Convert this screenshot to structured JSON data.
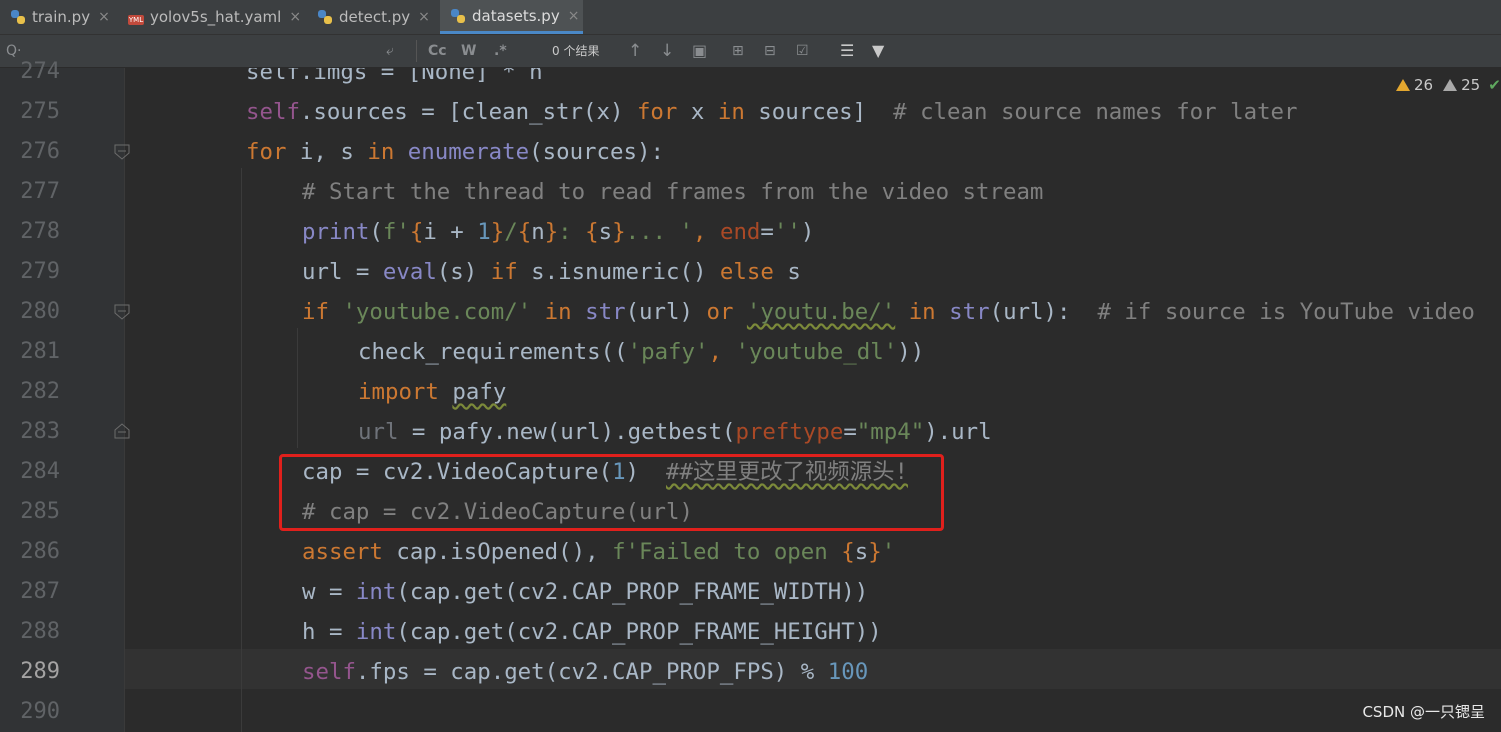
{
  "tabs": [
    {
      "label": "train.py",
      "icon": "python-file-icon",
      "active": false
    },
    {
      "label": "yolov5s_hat.yaml",
      "icon": "yaml-file-icon",
      "active": false
    },
    {
      "label": "detect.py",
      "icon": "python-file-icon",
      "active": false
    },
    {
      "label": "datasets.py",
      "icon": "python-file-icon",
      "active": true
    }
  ],
  "tab_close": "×",
  "find": {
    "search_glyph": "Q·",
    "match_case": "Cc",
    "words": "W",
    "regex": ".*",
    "results": "0 个结果"
  },
  "inspections": {
    "warnings": "26",
    "weak_warnings": "25"
  },
  "line_numbers": [
    "274",
    "275",
    "276",
    "277",
    "278",
    "279",
    "280",
    "281",
    "282",
    "283",
    "284",
    "285",
    "286",
    "287",
    "288",
    "289",
    "290"
  ],
  "code": {
    "l274": "self.imgs = [None] * n",
    "l275_a": "self",
    "l275_b": ".sources = [clean_str(x) ",
    "l275_c": "for",
    "l275_d": " x ",
    "l275_e": "in",
    "l275_f": " sources]  ",
    "l275_g": "# clean source names for later",
    "l276_a": "for",
    "l276_b": " i, s ",
    "l276_c": "in",
    "l276_d": " ",
    "l276_e": "enumerate",
    "l276_f": "(sources):",
    "l277": "# Start the thread to read frames from the video stream",
    "l278_a": "print",
    "l278_b": "(",
    "l278_c": "f'",
    "l278_d": "{",
    "l278_e": "i + ",
    "l278_f": "1",
    "l278_g": "}",
    "l278_h": "/",
    "l278_i": "{",
    "l278_j": "n",
    "l278_k": "}",
    "l278_l": ": ",
    "l278_m": "{",
    "l278_n": "s",
    "l278_o": "}",
    "l278_p": "... '",
    "l278_q": ", ",
    "l278_r": "end",
    "l278_s": "=",
    "l278_t": "''",
    "l278_u": ")",
    "l279_a": "url = ",
    "l279_b": "eval",
    "l279_c": "(s) ",
    "l279_d": "if",
    "l279_e": " s.isnumeric() ",
    "l279_f": "else",
    "l279_g": " s",
    "l280_a": "if",
    "l280_b": " ",
    "l280_c": "'youtube.com/'",
    "l280_d": " ",
    "l280_e": "in",
    "l280_f": " ",
    "l280_g": "str",
    "l280_h": "(url) ",
    "l280_i": "or",
    "l280_j": " ",
    "l280_k": "'youtu.be/'",
    "l280_l": " ",
    "l280_m": "in",
    "l280_n": " ",
    "l280_o": "str",
    "l280_p": "(url):  ",
    "l280_q": "# if source is YouTube video",
    "l281_a": "check_requirements((",
    "l281_b": "'pafy'",
    "l281_c": ", ",
    "l281_d": "'youtube_dl'",
    "l281_e": "))",
    "l282_a": "import",
    "l282_b": " ",
    "l282_c": "pafy",
    "l283_a": "url",
    "l283_b": " = pafy.new(url).getbest(",
    "l283_c": "preftype",
    "l283_d": "=",
    "l283_e": "\"mp4\"",
    "l283_f": ").url",
    "l284_a": "cap = cv2.VideoCapture(",
    "l284_b": "1",
    "l284_c": ")  ",
    "l284_d": "##这里更改了视频源头!",
    "l285": "# cap = cv2.VideoCapture(url)",
    "l286_a": "assert",
    "l286_b": " cap.isOpened(), ",
    "l286_c": "f'Failed to open ",
    "l286_d": "{",
    "l286_e": "s",
    "l286_f": "}",
    "l286_g": "'",
    "l287_a": "w = ",
    "l287_b": "int",
    "l287_c": "(cap.get(cv2.CAP_PROP_FRAME_WIDTH))",
    "l288_a": "h = ",
    "l288_b": "int",
    "l288_c": "(cap.get(cv2.CAP_PROP_FRAME_HEIGHT))",
    "l289_a": "self",
    "l289_b": ".fps = cap.get(cv2.CAP_PROP_FPS) % ",
    "l289_c": "100"
  },
  "watermark": "CSDN @一只锶呈",
  "colors": {
    "keyword": "#cc7832",
    "self": "#94558d",
    "builtin": "#8888c6",
    "string": "#6a8759",
    "number": "#6897bb",
    "comment": "#808080",
    "highlight_box": "#e0201c"
  }
}
